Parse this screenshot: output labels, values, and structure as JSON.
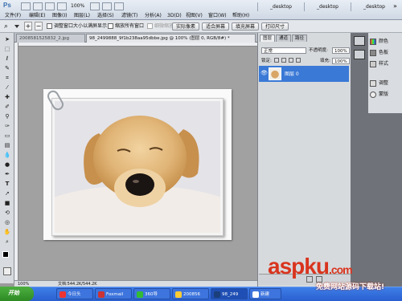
{
  "app": {
    "logo": "Ps",
    "zoom": "100%",
    "workspace_tabs": [
      "_desktop",
      "_desktop",
      "_desktop"
    ],
    "close_symbol": "»"
  },
  "menu": [
    "文件(F)",
    "编辑(E)",
    "图像(I)",
    "图层(L)",
    "选择(S)",
    "滤镜(T)",
    "分析(A)",
    "3D(D)",
    "视图(V)",
    "窗口(W)",
    "帮助(H)"
  ],
  "options_bar": {
    "resize_windows_label": "调整窗口大小以满屏显示",
    "zoom_all_label": "缩放所有窗口",
    "scrubby_label": "细微缩放",
    "actual_pixels": "实际像素",
    "fit_screen": "适合屏幕",
    "fill_screen": "填充屏幕",
    "print_size": "打印尺寸"
  },
  "document_tabs": [
    {
      "label": "2008581525832_2.jpg",
      "active": false
    },
    {
      "label": "98_2499888_9f1b238aa95dbbe.jpg @ 100% (图层 0, RGB/8#) *",
      "active": true
    }
  ],
  "status": {
    "zoom": "100%",
    "doc_info": "文档:544.2K/544.2K"
  },
  "layers_panel": {
    "tabs": [
      "图层",
      "通道",
      "路径"
    ],
    "blend_mode": "正常",
    "opacity_label": "不透明度:",
    "opacity_value": "100%",
    "lock_label": "锁定:",
    "fill_label": "填充:",
    "fill_value": "100%",
    "layer_name": "图层 0"
  },
  "dock": [
    {
      "label": "颜色",
      "icon": "color-icon"
    },
    {
      "label": "色板",
      "icon": "swatches-icon"
    },
    {
      "label": "样式",
      "icon": "styles-icon"
    },
    {
      "label": "调整",
      "icon": "adjustments-icon"
    },
    {
      "label": "蒙版",
      "icon": "masks-icon"
    }
  ],
  "taskbar": {
    "start": "开始",
    "tasks": [
      "今日头",
      "Foxmail",
      "360导",
      "200856",
      "98_249",
      "新建"
    ]
  },
  "watermark": {
    "logo": "aspku",
    "domain": ".com",
    "subtitle": "免费网站源码下载站!"
  },
  "colors": {
    "accent": "#3a79d6",
    "taskbar": "#2a5fcf",
    "watermark": "#d9341e"
  }
}
